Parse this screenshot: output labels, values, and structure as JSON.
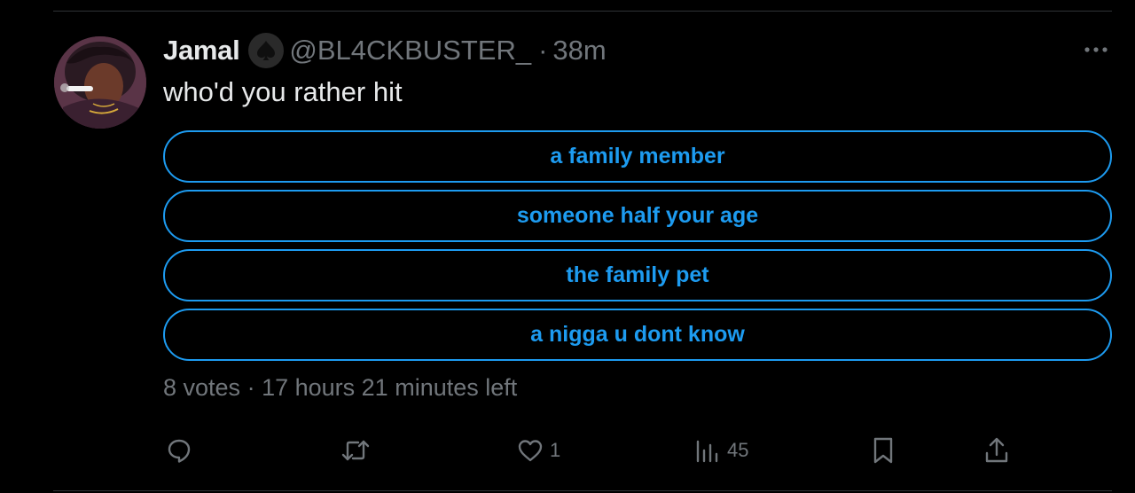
{
  "tweet": {
    "author": {
      "display_name": "Jamal",
      "badge_icon": "spade-icon",
      "handle": "@BL4CKBUSTER_",
      "separator": "·",
      "time": "38m"
    },
    "text": "who'd you rather hit",
    "poll": {
      "options": [
        {
          "label": "a family member"
        },
        {
          "label": "someone half your age"
        },
        {
          "label": "the family pet"
        },
        {
          "label": "a nigga u dont know"
        }
      ],
      "votes": "8 votes",
      "separator": "·",
      "time_left": "17 hours 21 minutes left"
    },
    "actions": {
      "reply": {
        "icon": "reply-icon",
        "count": ""
      },
      "retweet": {
        "icon": "retweet-icon",
        "count": ""
      },
      "like": {
        "icon": "heart-icon",
        "count": "1"
      },
      "views": {
        "icon": "views-icon",
        "count": "45"
      },
      "bookmark": {
        "icon": "bookmark-icon",
        "count": ""
      },
      "share": {
        "icon": "share-icon",
        "count": ""
      }
    }
  },
  "colors": {
    "background": "#000000",
    "accent": "#1d9bf0",
    "text_primary": "#e7e9ea",
    "text_secondary": "#71767b",
    "divider": "#2f3336"
  }
}
